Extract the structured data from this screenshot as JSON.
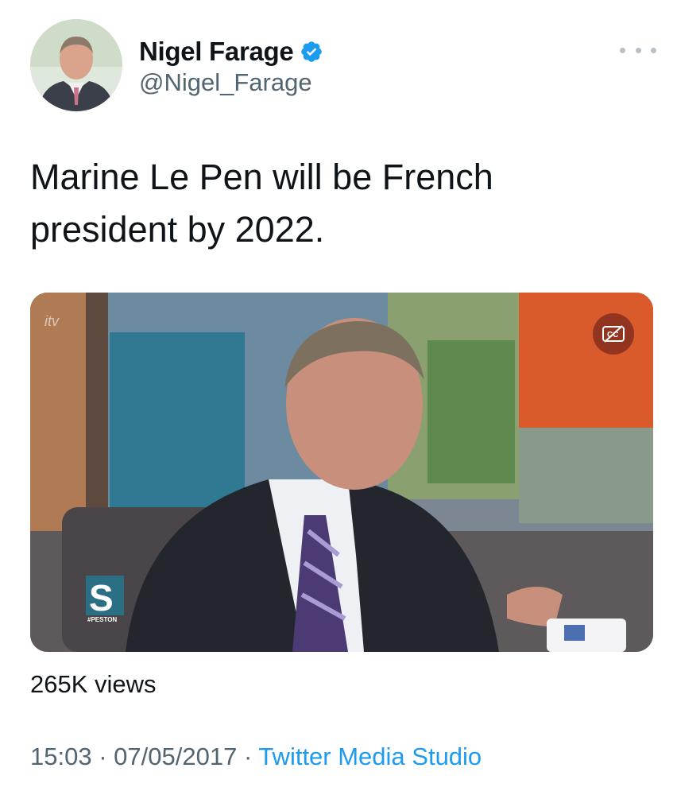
{
  "author": {
    "display_name": "Nigel Farage",
    "handle": "@Nigel_Farage",
    "verified": true
  },
  "tweet": {
    "text": "Marine Le Pen will be French president by 2022."
  },
  "media": {
    "channel_logo": "itv",
    "show_logo_text": "#PESTON",
    "captions_icon": "cc-icon"
  },
  "stats": {
    "views": "265K views"
  },
  "meta": {
    "time": "15:03",
    "separator": "·",
    "date": "07/05/2017",
    "source": "Twitter Media Studio"
  },
  "colors": {
    "link": "#1d9bf0",
    "verified": "#1d9bf0",
    "secondary_text": "#536471"
  },
  "icons": [
    "verified-badge-icon",
    "more-options-icon",
    "closed-captions-icon"
  ]
}
